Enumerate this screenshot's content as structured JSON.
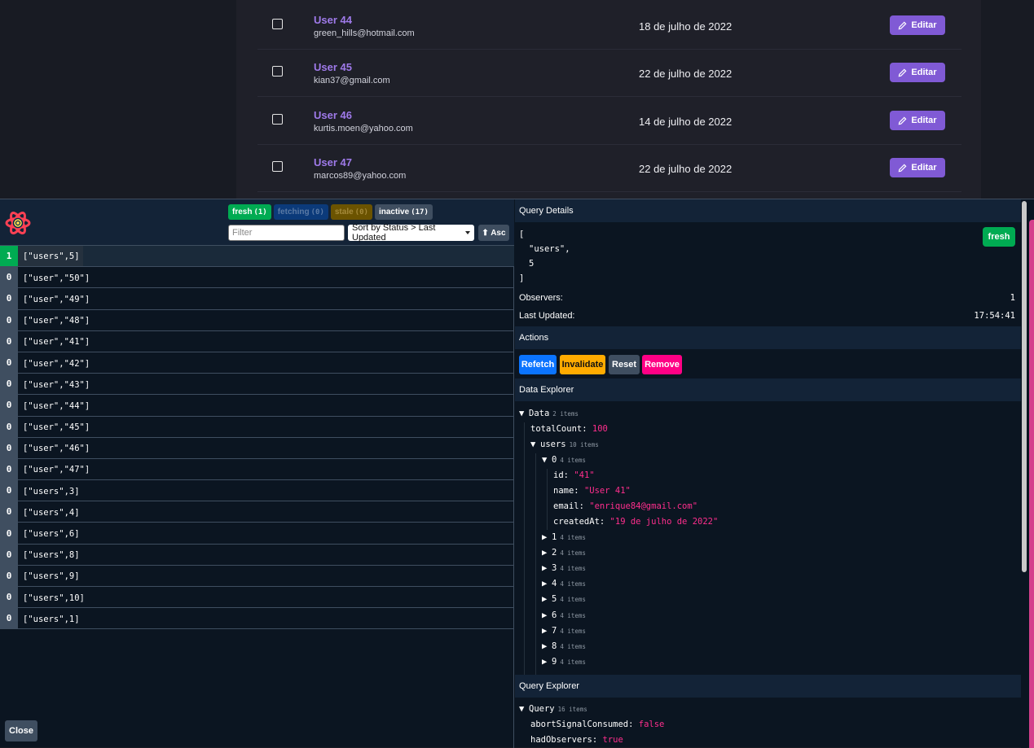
{
  "users": [
    {
      "name": "User 44",
      "email": "green_hills@hotmail.com",
      "date": "18 de julho de 2022",
      "edit_label": "Editar"
    },
    {
      "name": "User 45",
      "email": "kian37@gmail.com",
      "date": "22 de julho de 2022",
      "edit_label": "Editar"
    },
    {
      "name": "User 46",
      "email": "kurtis.moen@yahoo.com",
      "date": "14 de julho de 2022",
      "edit_label": "Editar"
    },
    {
      "name": "User 47",
      "email": "marcos89@yahoo.com",
      "date": "22 de julho de 2022",
      "edit_label": "Editar"
    }
  ],
  "devtools": {
    "counts": {
      "fresh": {
        "label": "fresh",
        "n": "(1)"
      },
      "fetching": {
        "label": "fetching",
        "n": "(0)"
      },
      "stale": {
        "label": "stale",
        "n": "(0)"
      },
      "inactive": {
        "label": "inactive",
        "n": "(17)"
      }
    },
    "filter_placeholder": "Filter",
    "sort_label": "Sort by Status > Last Updated",
    "asc_label": "⬆ Asc",
    "close_label": "Close",
    "queries": [
      {
        "count": "1",
        "key": "[\"users\",5]"
      },
      {
        "count": "0",
        "key": "[\"user\",\"50\"]"
      },
      {
        "count": "0",
        "key": "[\"user\",\"49\"]"
      },
      {
        "count": "0",
        "key": "[\"user\",\"48\"]"
      },
      {
        "count": "0",
        "key": "[\"user\",\"41\"]"
      },
      {
        "count": "0",
        "key": "[\"user\",\"42\"]"
      },
      {
        "count": "0",
        "key": "[\"user\",\"43\"]"
      },
      {
        "count": "0",
        "key": "[\"user\",\"44\"]"
      },
      {
        "count": "0",
        "key": "[\"user\",\"45\"]"
      },
      {
        "count": "0",
        "key": "[\"user\",\"46\"]"
      },
      {
        "count": "0",
        "key": "[\"user\",\"47\"]"
      },
      {
        "count": "0",
        "key": "[\"users\",3]"
      },
      {
        "count": "0",
        "key": "[\"users\",4]"
      },
      {
        "count": "0",
        "key": "[\"users\",6]"
      },
      {
        "count": "0",
        "key": "[\"users\",8]"
      },
      {
        "count": "0",
        "key": "[\"users\",9]"
      },
      {
        "count": "0",
        "key": "[\"users\",10]"
      },
      {
        "count": "0",
        "key": "[\"users\",1]"
      }
    ],
    "details": {
      "title": "Query Details",
      "key_lines": [
        "[",
        "\"users\",",
        "5",
        "]"
      ],
      "status": "fresh",
      "observers_label": "Observers:",
      "observers_value": "1",
      "updated_label": "Last Updated:",
      "updated_value": "17:54:41"
    },
    "actions": {
      "title": "Actions",
      "refetch": "Refetch",
      "invalidate": "Invalidate",
      "reset": "Reset",
      "remove": "Remove"
    },
    "data_explorer": {
      "title": "Data Explorer",
      "root_label": "Data",
      "root_items": "2 items",
      "total_key": "totalCount:",
      "total_val": "100",
      "users_key": "users",
      "users_items": "10 items",
      "item0_key": "0",
      "item0_items": "4 items",
      "fields": [
        {
          "k": "id:",
          "v": "\"41\""
        },
        {
          "k": "name:",
          "v": "\"User 41\""
        },
        {
          "k": "email:",
          "v": "\"enrique84@gmail.com\""
        },
        {
          "k": "createdAt:",
          "v": "\"19 de julho de 2022\""
        }
      ],
      "collapsed": [
        {
          "k": "1",
          "items": "4 items"
        },
        {
          "k": "2",
          "items": "4 items"
        },
        {
          "k": "3",
          "items": "4 items"
        },
        {
          "k": "4",
          "items": "4 items"
        },
        {
          "k": "5",
          "items": "4 items"
        },
        {
          "k": "6",
          "items": "4 items"
        },
        {
          "k": "7",
          "items": "4 items"
        },
        {
          "k": "8",
          "items": "4 items"
        },
        {
          "k": "9",
          "items": "4 items"
        }
      ]
    },
    "query_explorer": {
      "title": "Query Explorer",
      "root_label": "Query",
      "root_items": "16 items",
      "fields": [
        {
          "k": "abortSignalConsumed:",
          "v": "false"
        },
        {
          "k": "hadObservers:",
          "v": "true"
        }
      ]
    }
  }
}
